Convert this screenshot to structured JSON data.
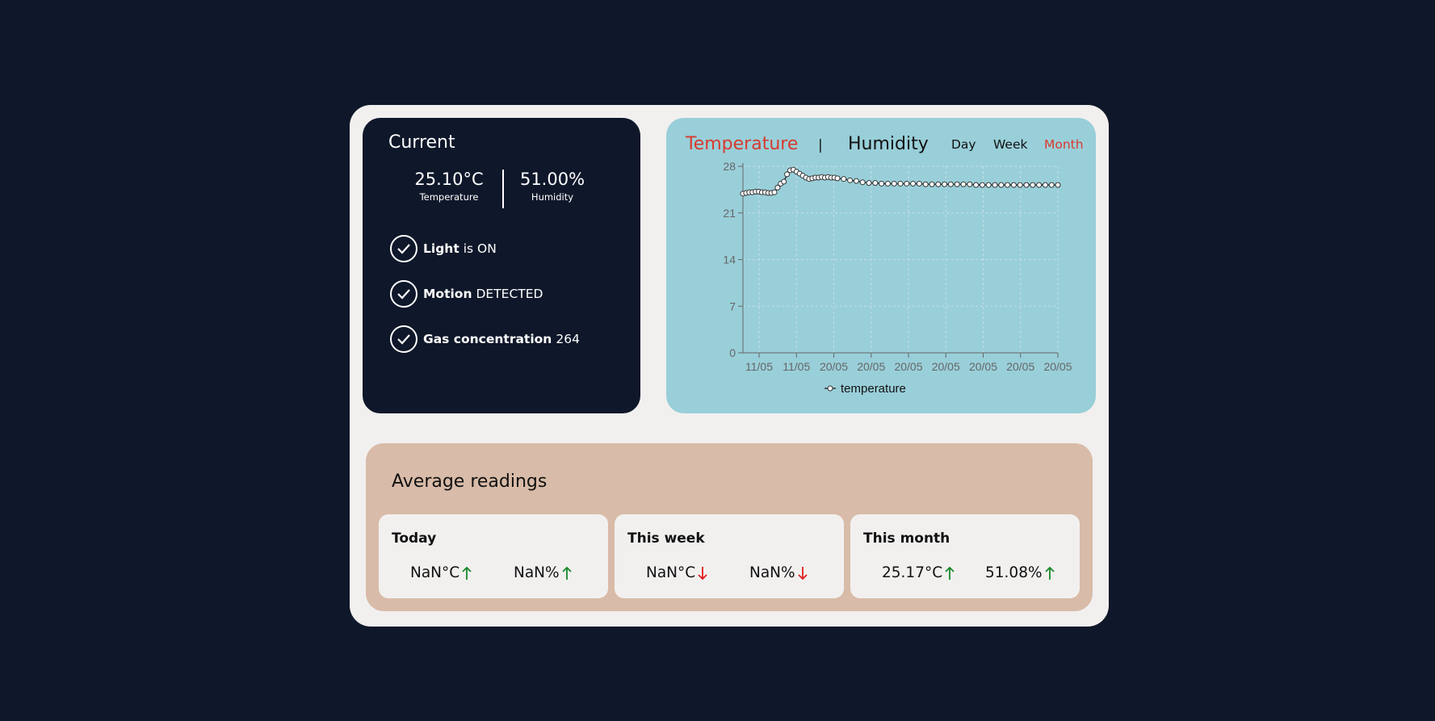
{
  "current": {
    "title": "Current",
    "temperature": "25.10°C",
    "temperature_label": "Temperature",
    "humidity": "51.00%",
    "humidity_label": "Humidity",
    "statuses": [
      {
        "bold": "Light",
        "text": "is ON"
      },
      {
        "bold": "Motion",
        "text": "DETECTED"
      },
      {
        "bold": "Gas concentration",
        "text": "264"
      }
    ]
  },
  "chart_panel": {
    "tab_temperature": "Temperature",
    "separator": "|",
    "tab_humidity": "Humidity",
    "range_day": "Day",
    "range_week": "Week",
    "range_month": "Month",
    "active_range": "Month"
  },
  "chart_data": {
    "type": "line",
    "ylim": [
      0,
      28
    ],
    "yticks": [
      0,
      7,
      14,
      21,
      28
    ],
    "xticks": [
      "11/05",
      "11/05",
      "20/05",
      "20/05",
      "20/05",
      "20/05",
      "20/05",
      "20/05",
      "20/05"
    ],
    "grid": true,
    "legend_position": "bottom",
    "series": [
      {
        "name": "temperature",
        "color": "#333333",
        "x": [
          0.0,
          0.01,
          0.02,
          0.03,
          0.04,
          0.05,
          0.06,
          0.07,
          0.08,
          0.09,
          0.1,
          0.11,
          0.12,
          0.13,
          0.14,
          0.15,
          0.16,
          0.17,
          0.18,
          0.19,
          0.2,
          0.21,
          0.22,
          0.23,
          0.24,
          0.25,
          0.26,
          0.27,
          0.28,
          0.29,
          0.3,
          0.32,
          0.34,
          0.36,
          0.38,
          0.4,
          0.42,
          0.44,
          0.46,
          0.48,
          0.5,
          0.52,
          0.54,
          0.56,
          0.58,
          0.6,
          0.62,
          0.64,
          0.66,
          0.68,
          0.7,
          0.72,
          0.74,
          0.76,
          0.78,
          0.8,
          0.82,
          0.84,
          0.86,
          0.88,
          0.9,
          0.92,
          0.94,
          0.96,
          0.98,
          1.0
        ],
        "values": [
          23.9,
          24.0,
          24.1,
          24.1,
          24.2,
          24.2,
          24.1,
          24.1,
          24.0,
          24.0,
          24.1,
          24.8,
          25.4,
          25.7,
          26.8,
          27.4,
          27.5,
          27.2,
          26.9,
          26.6,
          26.3,
          26.1,
          26.2,
          26.3,
          26.3,
          26.4,
          26.3,
          26.4,
          26.3,
          26.3,
          26.2,
          26.1,
          25.9,
          25.8,
          25.6,
          25.5,
          25.5,
          25.4,
          25.4,
          25.4,
          25.4,
          25.4,
          25.4,
          25.4,
          25.3,
          25.3,
          25.3,
          25.3,
          25.3,
          25.3,
          25.3,
          25.3,
          25.2,
          25.2,
          25.2,
          25.2,
          25.2,
          25.2,
          25.2,
          25.2,
          25.2,
          25.2,
          25.2,
          25.2,
          25.2,
          25.2
        ]
      }
    ]
  },
  "averages": {
    "title": "Average readings",
    "cards": [
      {
        "title": "Today",
        "temp": "NaN°C",
        "temp_trend": "up",
        "hum": "NaN%",
        "hum_trend": "up"
      },
      {
        "title": "This week",
        "temp": "NaN°C",
        "temp_trend": "down",
        "hum": "NaN%",
        "hum_trend": "down"
      },
      {
        "title": "This month",
        "temp": "25.17°C",
        "temp_trend": "up",
        "hum": "51.08%",
        "hum_trend": "up"
      }
    ]
  },
  "colors": {
    "background": "#0f172a",
    "accent_red": "#d83a2f",
    "trend_up": "#17882a",
    "trend_down": "#e01e1e",
    "chart_bg": "#99cfd9",
    "avg_bg": "#d8bba8"
  }
}
